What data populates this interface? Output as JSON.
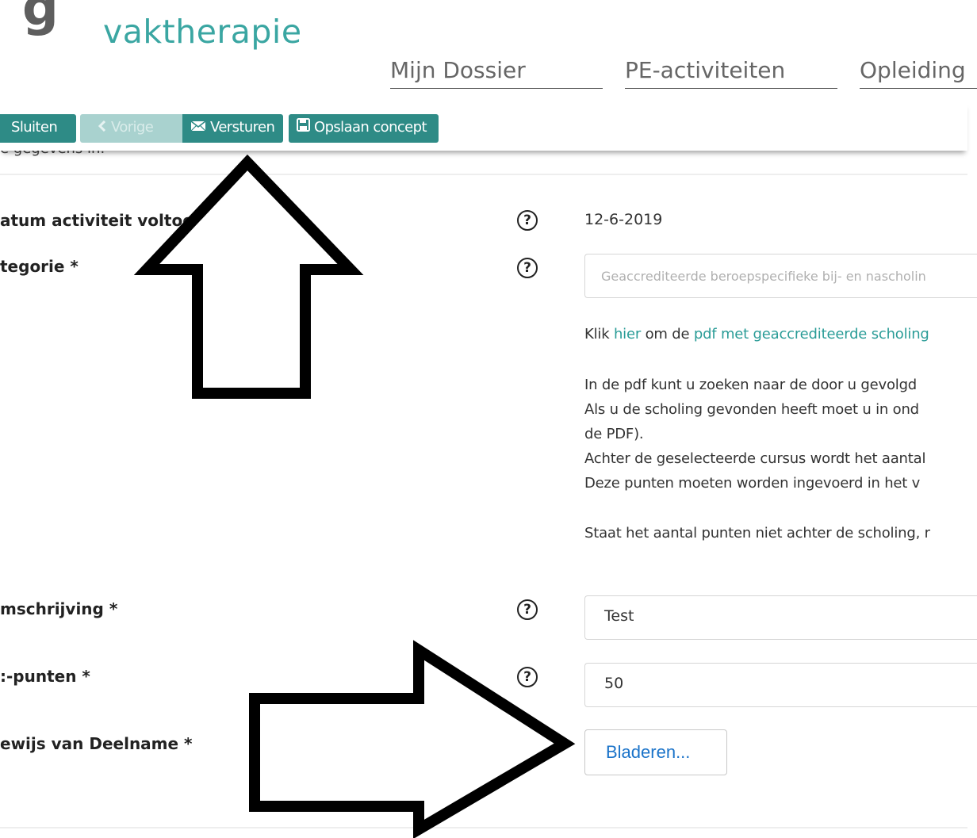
{
  "header": {
    "logo_glyph": "g",
    "logo_subtitle": "vaktherapie",
    "nav": [
      "Mijn Dossier",
      "PE-activiteiten",
      "Opleiding"
    ]
  },
  "toolbar": {
    "close_label": "Sluiten",
    "prev_label": "Vorige",
    "send_label": "Versturen",
    "save_label": "Opslaan concept"
  },
  "intro_text": "e gegevens in.",
  "form": {
    "date": {
      "label": "atum activiteit voltooid",
      "value": "12-6-2019"
    },
    "category": {
      "label": "tegorie *",
      "placeholder": "Geaccrediteerde beroepspecifieke bij- en nascholin",
      "info_link_line": {
        "prefix": "Klik ",
        "link1": "hier",
        "middle": " om de ",
        "link2": "pdf met geaccrediteerde scholing"
      },
      "info_lines": [
        "In de pdf kunt u zoeken naar de door u gevolgd",
        "Als u de scholing gevonden heeft moet u in ond",
        "de PDF).",
        "Achter de geselecteerde cursus wordt het aantal",
        "Deze punten moeten worden ingevoerd in het v"
      ],
      "info_footer": "Staat het aantal punten niet achter de scholing, r"
    },
    "description": {
      "label": "mschrijving *",
      "value": "Test"
    },
    "points": {
      "label": ":-punten *",
      "value": "50"
    },
    "proof": {
      "label": "ewijs van Deelname  *",
      "button_label": "Bladeren..."
    },
    "help_glyph": "?"
  },
  "icons": {
    "prev": "chevron-left-icon",
    "send": "envelope-icon",
    "save": "floppy-disk-icon",
    "help": "question-circle-icon"
  },
  "colors": {
    "accent": "#2e8b86",
    "accent_disabled": "#a9d2cf",
    "link": "#2a9c97",
    "logo": "#3aa6a2",
    "browse_text": "#1a73c9"
  }
}
